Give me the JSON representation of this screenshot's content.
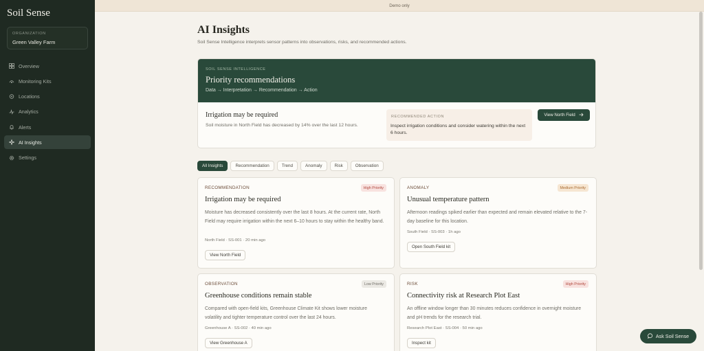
{
  "app": {
    "title": "Soil Sense"
  },
  "org": {
    "label": "ORGANIZATION",
    "name": "Green Valley Farm"
  },
  "nav": [
    {
      "label": "Overview",
      "icon": "grid-icon"
    },
    {
      "label": "Monitoring Kits",
      "icon": "sensor-icon"
    },
    {
      "label": "Locations",
      "icon": "pin-icon"
    },
    {
      "label": "Analytics",
      "icon": "pulse-icon"
    },
    {
      "label": "Alerts",
      "icon": "bell-icon"
    },
    {
      "label": "AI Insights",
      "icon": "sparkle-icon",
      "active": true
    },
    {
      "label": "Settings",
      "icon": "gear-icon"
    }
  ],
  "banner": "Demo only",
  "page": {
    "title": "AI Insights",
    "subtitle": "Soil Sense Intelligence interprets sensor patterns into observations, risks, and recommended actions."
  },
  "priority": {
    "label": "SOIL SENSE INTELLIGENCE",
    "title": "Priority recommendations",
    "flow": "Data → Interpretation → Recommendation → Action",
    "item_title": "Irrigation may be required",
    "item_text": "Soil moisture in North Field has decreased by 14% over the last 12 hours.",
    "rec_label": "RECOMMENDED ACTION",
    "rec_text": "Inspect irrigation conditions and consider watering within the next 6 hours.",
    "button": "View North Field"
  },
  "filters": [
    "All Insights",
    "Recommendation",
    "Trend",
    "Anomaly",
    "Risk",
    "Observation"
  ],
  "cards": [
    {
      "type": "RECOMMENDATION",
      "badge": "High Priority",
      "title": "Irrigation may be required",
      "body": "Moisture has decreased consistently over the last 8 hours. At the current rate, North Field may require irrigation within the next 6–10 hours to stay within the healthy band.",
      "meta": "North Field · SS-001 · 20 min ago",
      "button": "View North Field"
    },
    {
      "type": "ANOMALY",
      "badge": "Medium Priority",
      "title": "Unusual temperature pattern",
      "body": "Afternoon readings spiked earlier than expected and remain elevated relative to the 7-day baseline for this location.",
      "meta": "South Field · SS-003 · 1h ago",
      "button": "Open South Field kit"
    },
    {
      "type": "OBSERVATION",
      "badge": "Low Priority",
      "title": "Greenhouse conditions remain stable",
      "body": "Compared with open-field kits, Greenhouse Climate Kit shows lower moisture volatility and tighter temperature control over the last 24 hours.",
      "meta": "Greenhouse A · SS-002 · 40 min ago",
      "button": "View Greenhouse A"
    },
    {
      "type": "RISK",
      "badge": "High Priority",
      "title": "Connectivity risk at Research Plot East",
      "body": "An offline window longer than 30 minutes reduces confidence in overnight moisture and pH trends for the research trial.",
      "meta": "Research Plot East · SS-004 · 50 min ago",
      "button": "Inspect kit"
    }
  ],
  "ask": "Ask Soil Sense",
  "colors": {
    "sidebar": "#1f2a22",
    "accent": "#29493a",
    "high_badge_bg": "#f8e2df",
    "high_badge_text": "#b0473c",
    "medium_badge_bg": "#f6e6d2",
    "medium_badge_text": "#a8692e",
    "low_badge_bg": "#ebe9e4",
    "low_badge_text": "#6f6d66"
  }
}
